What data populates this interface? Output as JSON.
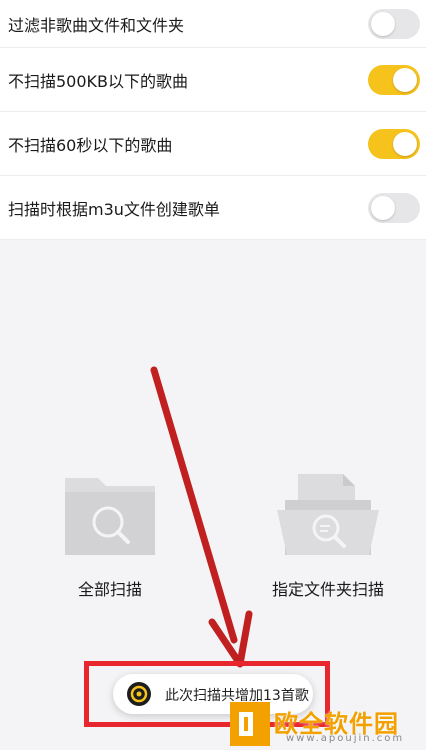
{
  "settings": [
    {
      "label": "过滤非歌曲文件和文件夹",
      "enabled": false
    },
    {
      "label": "不扫描500KB以下的歌曲",
      "enabled": true
    },
    {
      "label": "不扫描60秒以下的歌曲",
      "enabled": true
    },
    {
      "label": "扫描时根据m3u文件创建歌单",
      "enabled": false
    }
  ],
  "scan_options": {
    "all": "全部扫描",
    "folder": "指定文件夹扫描"
  },
  "toast": {
    "message": "此次扫描共增加13首歌"
  },
  "watermark": {
    "title": "欧全软件园",
    "url": "www.apoujin.com"
  },
  "colors": {
    "toggle_on": "#f6c21c",
    "toggle_off": "#e6e6e8",
    "highlight": "#e8262d",
    "watermark": "#f2a100"
  }
}
